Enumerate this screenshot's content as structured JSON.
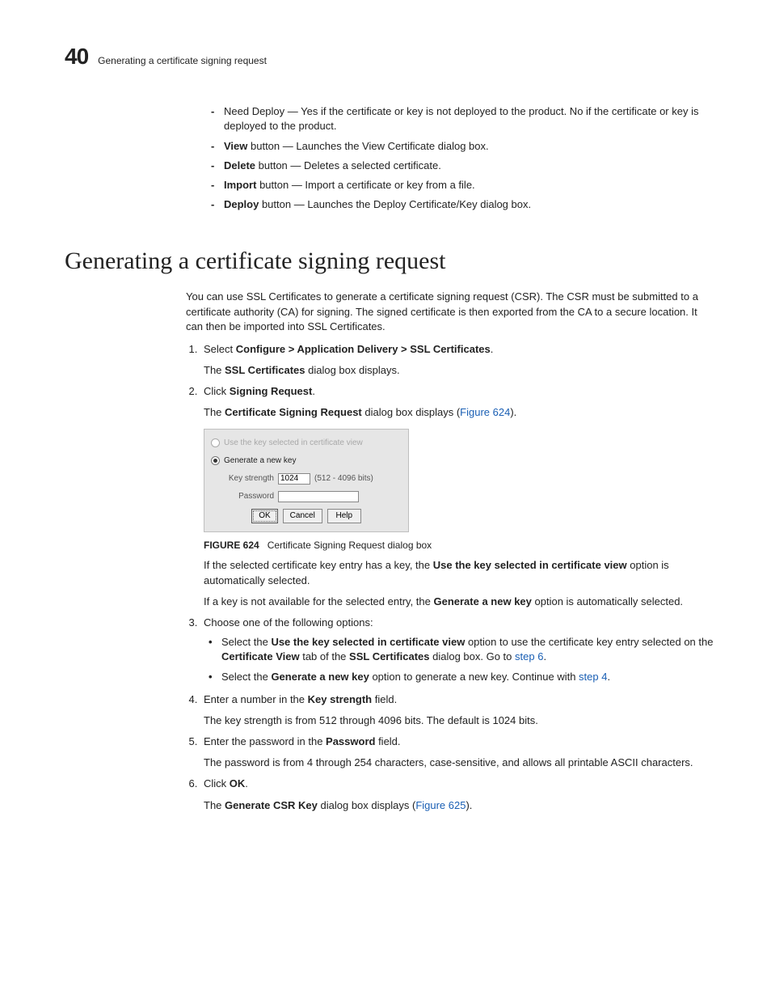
{
  "header": {
    "chapter_number": "40",
    "running_title": "Generating a certificate signing request"
  },
  "top_list": {
    "need_deploy": "Need Deploy — Yes if the certificate or key is not deployed to the product. No if the certificate or key is deployed to the product.",
    "view_bold": "View",
    "view_rest": " button — Launches the View Certificate dialog box.",
    "delete_bold": "Delete",
    "delete_rest": " button — Deletes a selected certificate.",
    "import_bold": "Import",
    "import_rest": " button — Import a certificate or key from a file.",
    "deploy_bold": "Deploy",
    "deploy_rest": " button — Launches the Deploy Certificate/Key dialog box."
  },
  "section_heading": "Generating a certificate signing request",
  "intro_para": "You can use SSL Certificates to generate a certificate signing request (CSR). The CSR must be submitted to a certificate authority (CA) for signing. The signed certificate is then exported from the CA to a secure location. It can then be imported into SSL Certificates.",
  "step1": {
    "pre": "Select ",
    "bold": "Configure > Application Delivery > SSL Certificates",
    "post": ".",
    "result_pre": "The ",
    "result_bold": "SSL Certificates",
    "result_post": " dialog box displays."
  },
  "step2": {
    "pre": "Click ",
    "bold": "Signing Request",
    "post": ".",
    "result_pre": "The ",
    "result_bold": "Certificate Signing Request",
    "result_post": " dialog box displays (",
    "link": "Figure 624",
    "result_end": ")."
  },
  "dialog": {
    "opt1": "Use the key selected in certificate view",
    "opt2": "Generate a new key",
    "keystrength_label": "Key strength",
    "keystrength_value": "1024",
    "keystrength_hint": "(512 - 4096 bits)",
    "password_label": "Password",
    "ok": "OK",
    "cancel": "Cancel",
    "help": "Help"
  },
  "figure": {
    "label": "FIGURE 624",
    "caption": "Certificate Signing Request dialog box"
  },
  "post_fig_p1_pre": "If the selected certificate key entry has a key, the ",
  "post_fig_p1_bold": "Use the key selected in certificate view",
  "post_fig_p1_post": " option is automatically selected.",
  "post_fig_p2_pre": "If a key is not available for the selected entry, the ",
  "post_fig_p2_bold": "Generate a new key",
  "post_fig_p2_post": " option is automatically selected.",
  "step3": {
    "text": "Choose one of the following options:",
    "bullet1_a": "Select the ",
    "bullet1_b": "Use the key selected in certificate view",
    "bullet1_c": " option to use the certificate key entry selected on the ",
    "bullet1_d": "Certificate View",
    "bullet1_e": " tab of the ",
    "bullet1_f": "SSL Certificates",
    "bullet1_g": " dialog box. Go to ",
    "bullet1_link": "step 6",
    "bullet1_end": ".",
    "bullet2_a": "Select the ",
    "bullet2_b": "Generate a new key",
    "bullet2_c": " option to generate a new key. Continue with ",
    "bullet2_link": "step 4",
    "bullet2_end": "."
  },
  "step4": {
    "pre": "Enter a number in the ",
    "bold": "Key strength",
    "post": " field.",
    "result": "The key strength is from 512 through 4096 bits. The default is 1024 bits."
  },
  "step5": {
    "pre": "Enter the password in the ",
    "bold": "Password",
    "post": " field.",
    "result": "The password is from 4 through 254 characters, case-sensitive, and allows all printable ASCII characters."
  },
  "step6": {
    "pre": "Click ",
    "bold": "OK",
    "post": ".",
    "result_pre": "The ",
    "result_bold": "Generate CSR Key",
    "result_post": " dialog box displays (",
    "link": "Figure 625",
    "result_end": ")."
  }
}
